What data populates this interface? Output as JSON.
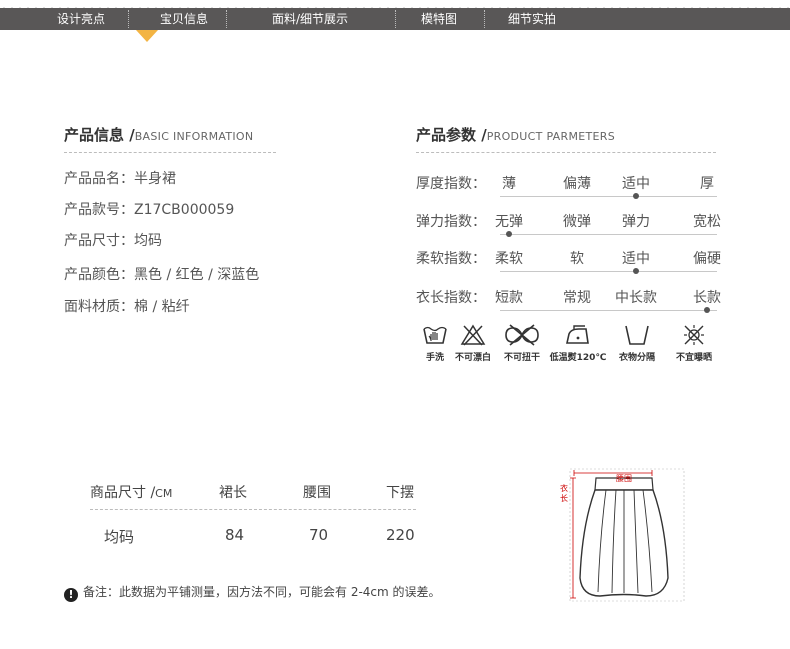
{
  "nav": {
    "items": [
      "设计亮点",
      "宝贝信息",
      "面料/细节展示",
      "模特图",
      "细节实拍"
    ],
    "active_index": 1
  },
  "product_info": {
    "title": "产品信息 /",
    "subtitle": "BASIC INFORMATION",
    "rows": [
      {
        "label": "产品品名：",
        "value": "半身裙"
      },
      {
        "label": "产品款号：",
        "value": "Z17CB000059"
      },
      {
        "label": "产品尺寸：",
        "value": "均码"
      },
      {
        "label": "产品颜色：",
        "value": "黑色 / 红色 / 深蓝色"
      },
      {
        "label": "面料材质：",
        "value": "棉 / 粘纤"
      }
    ]
  },
  "parameters": {
    "title": "产品参数 /",
    "subtitle": "PRODUCT PARMETERS",
    "rows": [
      {
        "label": "厚度指数：",
        "options": [
          "薄",
          "偏薄",
          "适中",
          "厚"
        ],
        "selected_index": 2
      },
      {
        "label": "弹力指数：",
        "options": [
          "无弹",
          "微弹",
          "弹力",
          "宽松"
        ],
        "selected_index": 0
      },
      {
        "label": "柔软指数：",
        "options": [
          "柔软",
          "软",
          "适中",
          "偏硬"
        ],
        "selected_index": 2
      },
      {
        "label": "衣长指数：",
        "options": [
          "短款",
          "常规",
          "中长款",
          "长款"
        ],
        "selected_index": 3
      }
    ]
  },
  "care": [
    {
      "icon": "hand-wash-icon",
      "label": "手洗"
    },
    {
      "icon": "no-bleach-icon",
      "label": "不可漂白"
    },
    {
      "icon": "no-wring-icon",
      "label": "不可扭干"
    },
    {
      "icon": "low-iron-icon",
      "label": "低温熨120℃"
    },
    {
      "icon": "tumble-dry-icon",
      "label": "衣物分隔"
    },
    {
      "icon": "no-sun-dry-icon",
      "label": "不宜曝晒"
    }
  ],
  "size_table": {
    "headers": [
      "商品尺寸 /",
      "裙长",
      "腰围",
      "下摆"
    ],
    "unit": "CM",
    "rows": [
      {
        "size": "均码",
        "length": "84",
        "waist": "70",
        "hem": "220"
      }
    ]
  },
  "note": {
    "icon": "!",
    "text": "备注：此数据为平铺测量，因方法不同，可能会有 2-4cm 的误差。"
  },
  "diagram": {
    "waist_label": "腰围",
    "length_label": "衣长"
  },
  "colors": {
    "nav_bg": "#595757",
    "nav_pointer": "#f3b443",
    "accent_red": "#c00000"
  }
}
